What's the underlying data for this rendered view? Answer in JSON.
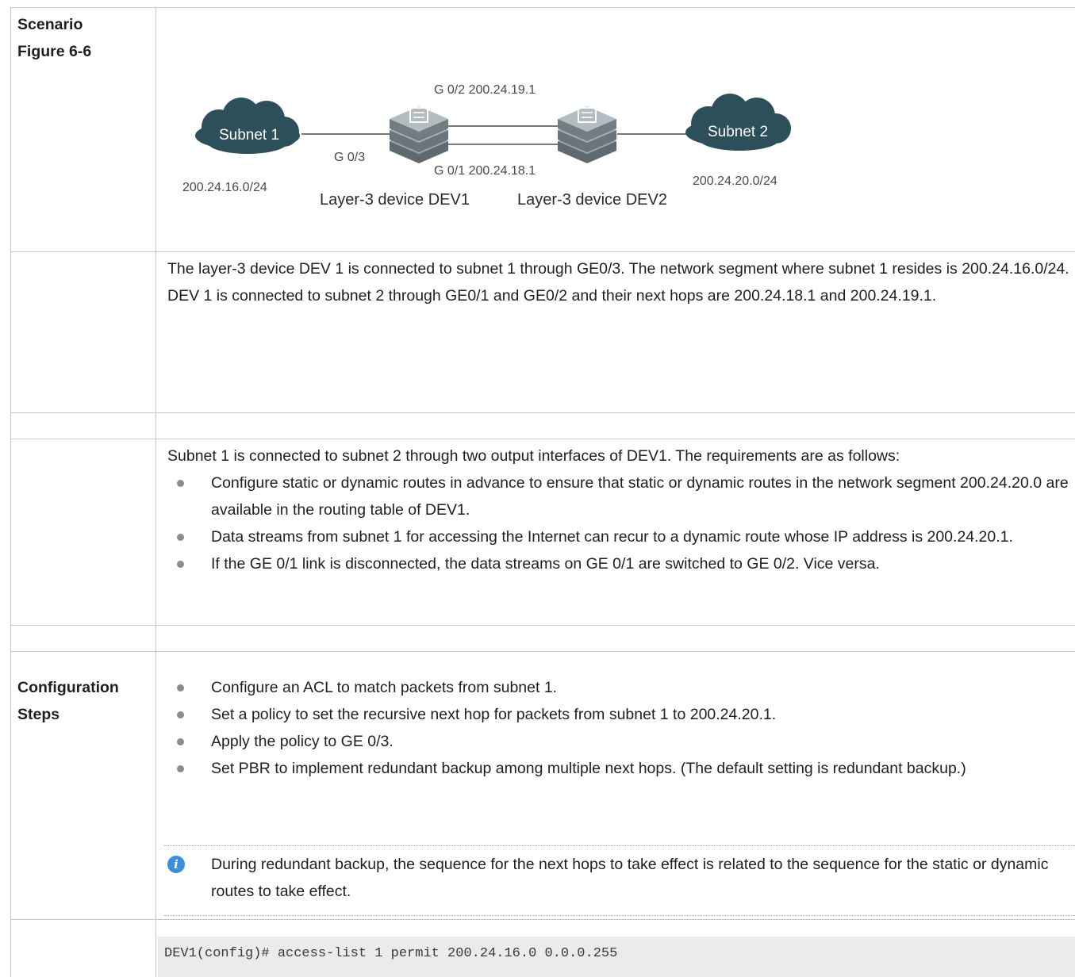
{
  "labels": {
    "scenario": "Scenario",
    "figure": "Figure 6-6",
    "config1": "Configuration",
    "config2": "Steps"
  },
  "diagram": {
    "subnet1": "Subnet 1",
    "subnet2": "Subnet 2",
    "subnet1_addr": "200.24.16.0/24",
    "subnet2_addr": "200.24.20.0/24",
    "port_g03": "G 0/3",
    "port_g02": "G 0/2 200.24.19.1",
    "port_g01": "G 0/1 200.24.18.1",
    "dev1": "Layer-3 device DEV1",
    "dev2": "Layer-3 device DEV2",
    "cloud_color": "#2d4f5a",
    "device_color": "#8a949a"
  },
  "description": {
    "line1": "The layer-3 device DEV 1 is connected to subnet 1 through GE0/3. The network segment where subnet 1 resides is 200.24.16.0/24.",
    "line2": "DEV 1 is connected to subnet 2 through GE0/1 and GE0/2 and their next hops are 200.24.18.1 and 200.24.19.1."
  },
  "requirements": {
    "intro": "Subnet 1 is connected to subnet 2 through two output interfaces of DEV1. The requirements are as follows:",
    "items": [
      "Configure static or dynamic routes in advance to ensure that static or dynamic routes in the network segment 200.24.20.0 are available in the routing table of DEV1.",
      "Data streams from subnet 1 for accessing the Internet can recur to a dynamic route whose IP address is 200.24.20.1.",
      "If the GE 0/1 link is disconnected, the data streams on GE 0/1 are switched to GE 0/2. Vice versa."
    ]
  },
  "steps": {
    "items": [
      "Configure an ACL to match packets from subnet 1.",
      "Set a policy to set the recursive next hop for packets from subnet 1 to 200.24.20.1.",
      "Apply the policy to GE 0/3.",
      "Set PBR to implement redundant backup among multiple next hops. (The default setting is redundant backup.)"
    ],
    "note": "During redundant backup, the sequence for the next hops to take effect is related to the sequence for the static or dynamic routes to take effect.",
    "note_icon": "info-icon"
  },
  "code": {
    "line1": "DEV1(config)# access-list 1 permit 200.24.16.0 0.0.0.255"
  }
}
